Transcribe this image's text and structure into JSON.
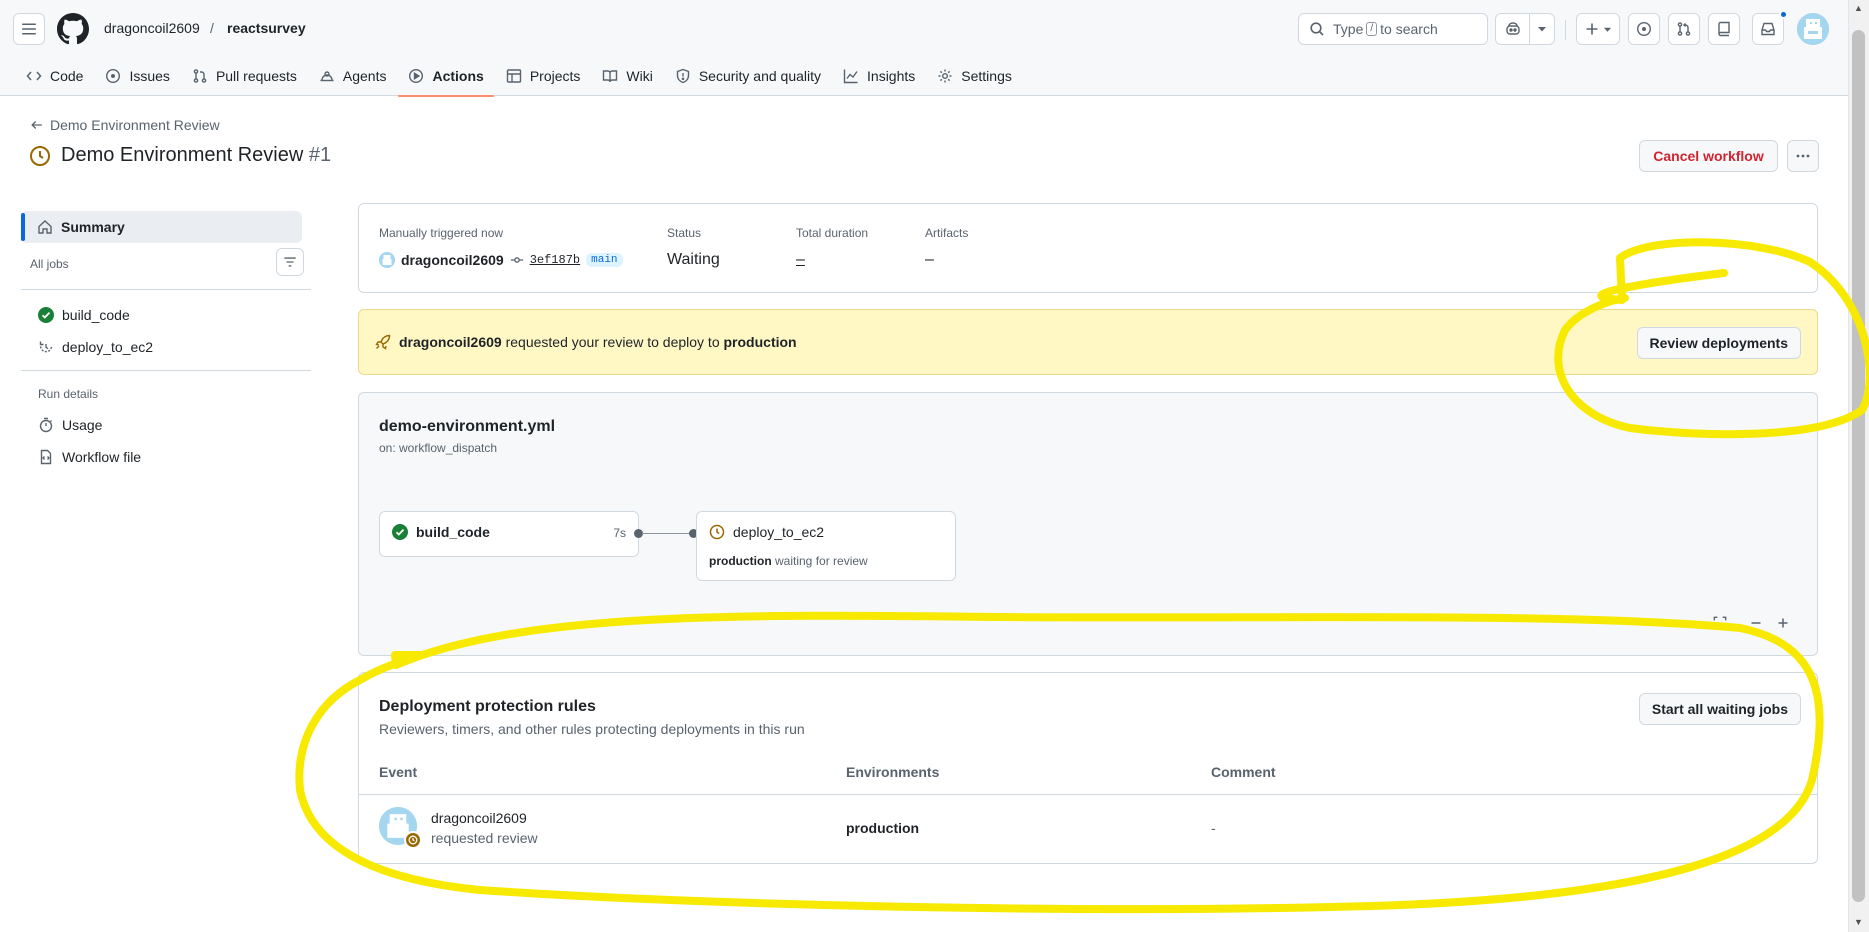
{
  "header": {
    "owner": "dragoncoil2609",
    "separator": "/",
    "repo": "reactsurvey",
    "search_type": "Type",
    "search_key": "/",
    "search_suffix": "to search"
  },
  "tabs": [
    {
      "label": "Code",
      "icon": "code-icon"
    },
    {
      "label": "Issues",
      "icon": "issue-icon"
    },
    {
      "label": "Pull requests",
      "icon": "pull-request-icon"
    },
    {
      "label": "Agents",
      "icon": "agents-icon"
    },
    {
      "label": "Actions",
      "icon": "play-icon",
      "active": true
    },
    {
      "label": "Projects",
      "icon": "table-icon"
    },
    {
      "label": "Wiki",
      "icon": "book-icon"
    },
    {
      "label": "Security and quality",
      "icon": "shield-icon"
    },
    {
      "label": "Insights",
      "icon": "graph-icon"
    },
    {
      "label": "Settings",
      "icon": "gear-icon"
    }
  ],
  "page": {
    "back_label": "Demo Environment Review",
    "title": "Demo Environment Review",
    "run_number": "#1",
    "cancel_label": "Cancel workflow"
  },
  "sidebar": {
    "summary": "Summary",
    "all_jobs": "All jobs",
    "jobs": [
      {
        "name": "build_code",
        "status": "success"
      },
      {
        "name": "deploy_to_ec2",
        "status": "waiting"
      }
    ],
    "run_details": "Run details",
    "details": [
      {
        "label": "Usage",
        "icon": "stopwatch-icon"
      },
      {
        "label": "Workflow file",
        "icon": "file-code-icon"
      }
    ]
  },
  "summary": {
    "trigger_label": "Manually triggered now",
    "actor": "dragoncoil2609",
    "sha": "3ef187b",
    "branch": "main",
    "status_label": "Status",
    "status_value": "Waiting",
    "duration_label": "Total duration",
    "duration_value": "–",
    "artifacts_label": "Artifacts",
    "artifacts_value": "–"
  },
  "review": {
    "actor": "dragoncoil2609",
    "middle": "requested your review to deploy to",
    "environment": "production",
    "button": "Review deployments"
  },
  "graph": {
    "file": "demo-environment.yml",
    "trigger": "on: workflow_dispatch",
    "jobs": [
      {
        "name": "build_code",
        "duration": "7s"
      },
      {
        "name": "deploy_to_ec2",
        "env": "production",
        "note": "waiting for review"
      }
    ]
  },
  "rules": {
    "title": "Deployment protection rules",
    "subtitle": "Reviewers, timers, and other rules protecting deployments in this run",
    "button": "Start all waiting jobs",
    "columns": [
      "Event",
      "Environments",
      "Comment"
    ],
    "row": {
      "user": "dragoncoil2609",
      "action": "requested review",
      "environment": "production",
      "comment": "-"
    }
  },
  "colors": {
    "accent": "#0969da",
    "danger": "#d1242f",
    "success": "#1a7f37",
    "attention": "#9a6700",
    "banner_bg": "#fff8c5",
    "annotation": "#f7ea00"
  }
}
